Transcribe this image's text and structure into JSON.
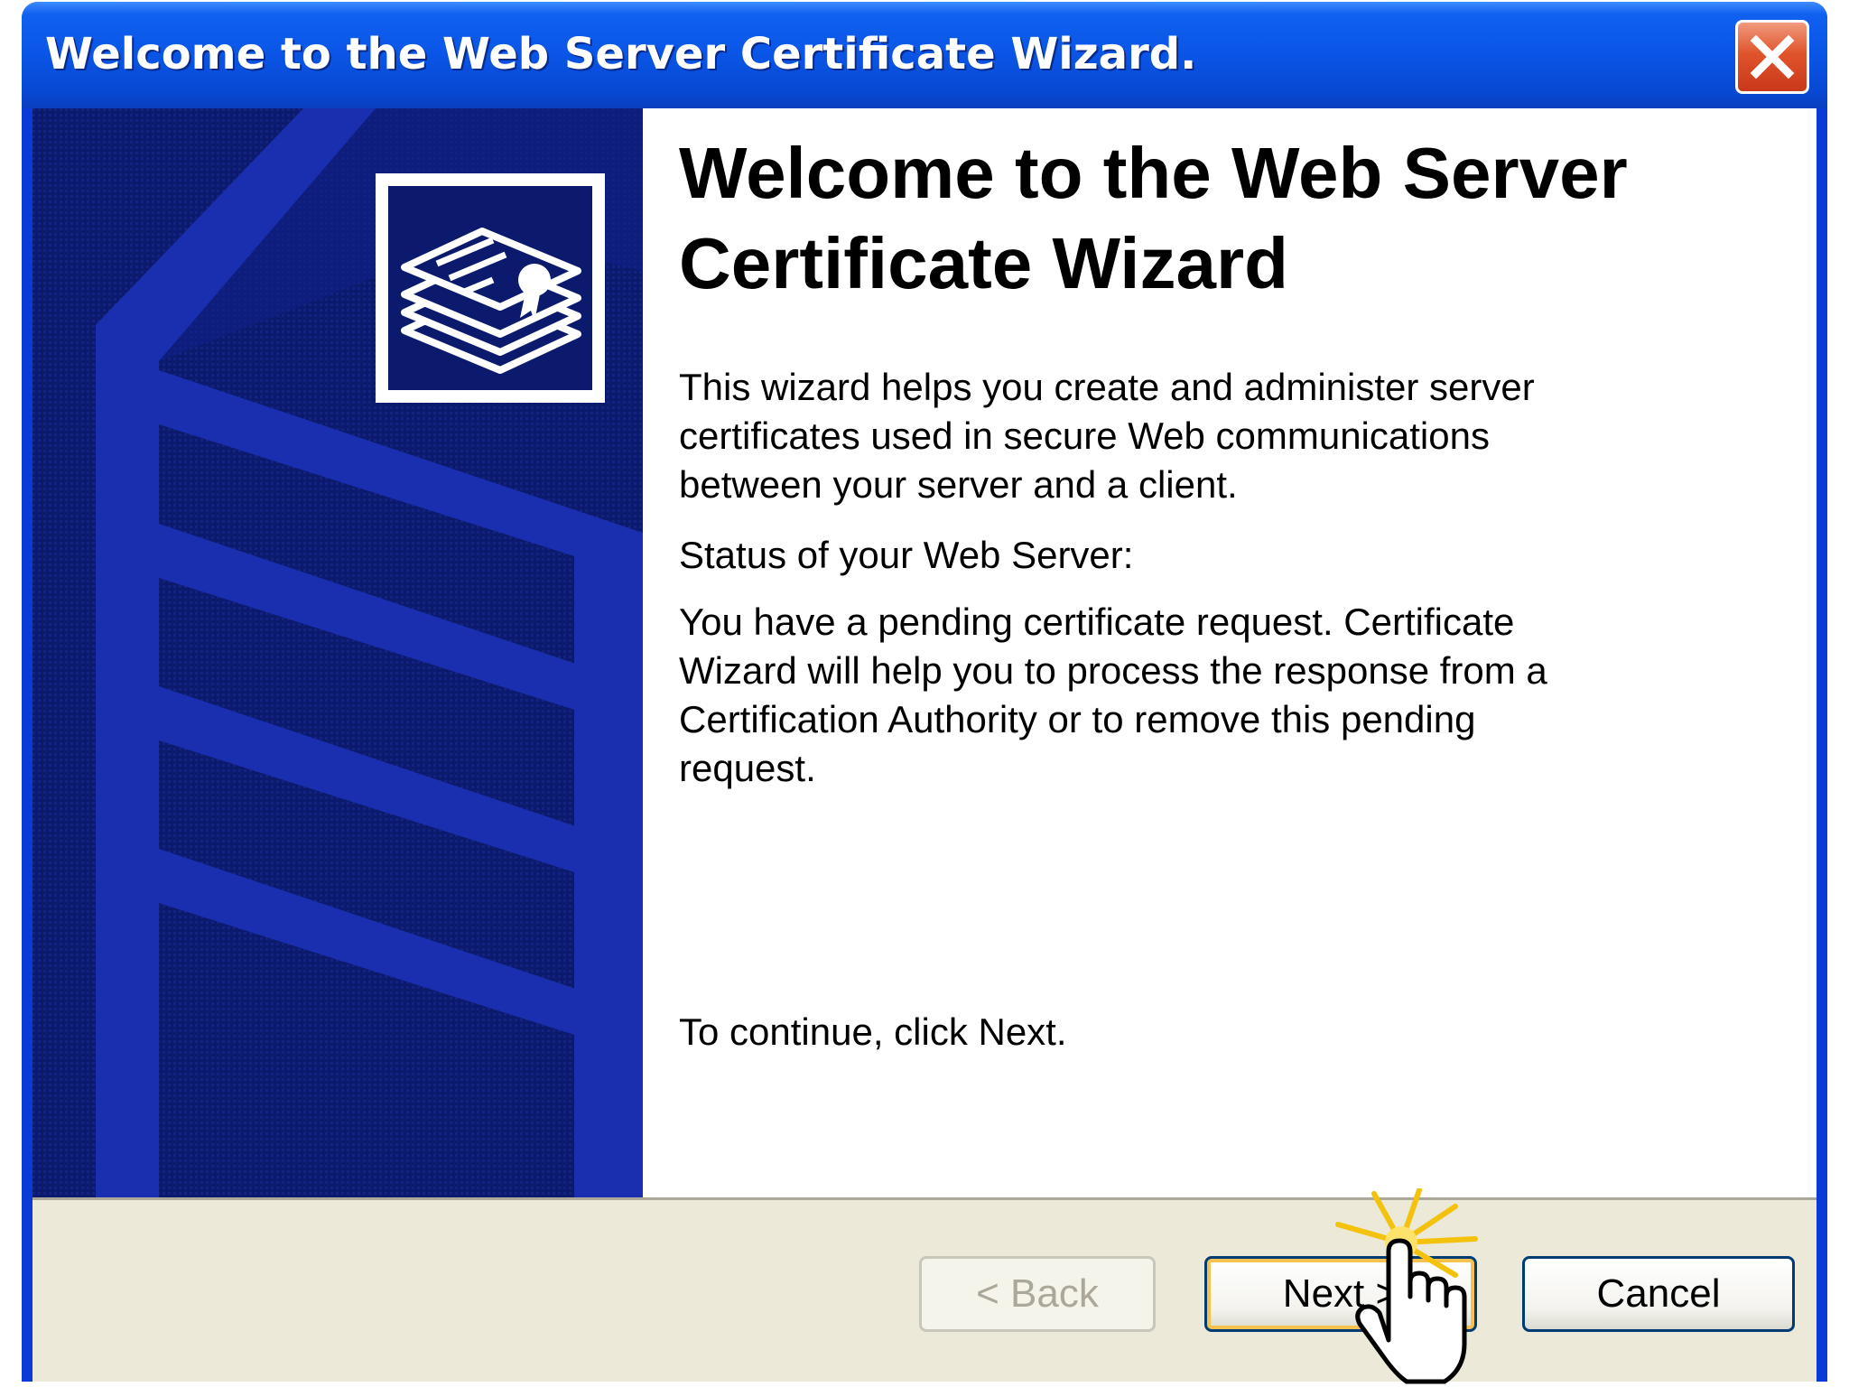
{
  "window": {
    "title": "Welcome to the Web Server Certificate Wizard."
  },
  "content": {
    "heading": "Welcome to the Web Server Certificate Wizard",
    "intro": "This wizard helps you create and administer server certificates used in secure Web communications between your server and a client.",
    "status_label": "Status of your Web Server:",
    "status_text": "You have a pending certificate request. Certificate Wizard will help you to process the response from a Certification Authority or to remove this pending request.",
    "continue_text": "To continue, click Next."
  },
  "buttons": {
    "back": "< Back",
    "next": "Next >",
    "cancel": "Cancel"
  },
  "icons": {
    "close": "close-icon",
    "banner": "certificate-icon",
    "cursor": "hand-pointer-icon"
  },
  "colors": {
    "titlebar": "#0a55e6",
    "banner": "#0c1a6e",
    "footer": "#ece9d8",
    "close": "#e0542c"
  }
}
